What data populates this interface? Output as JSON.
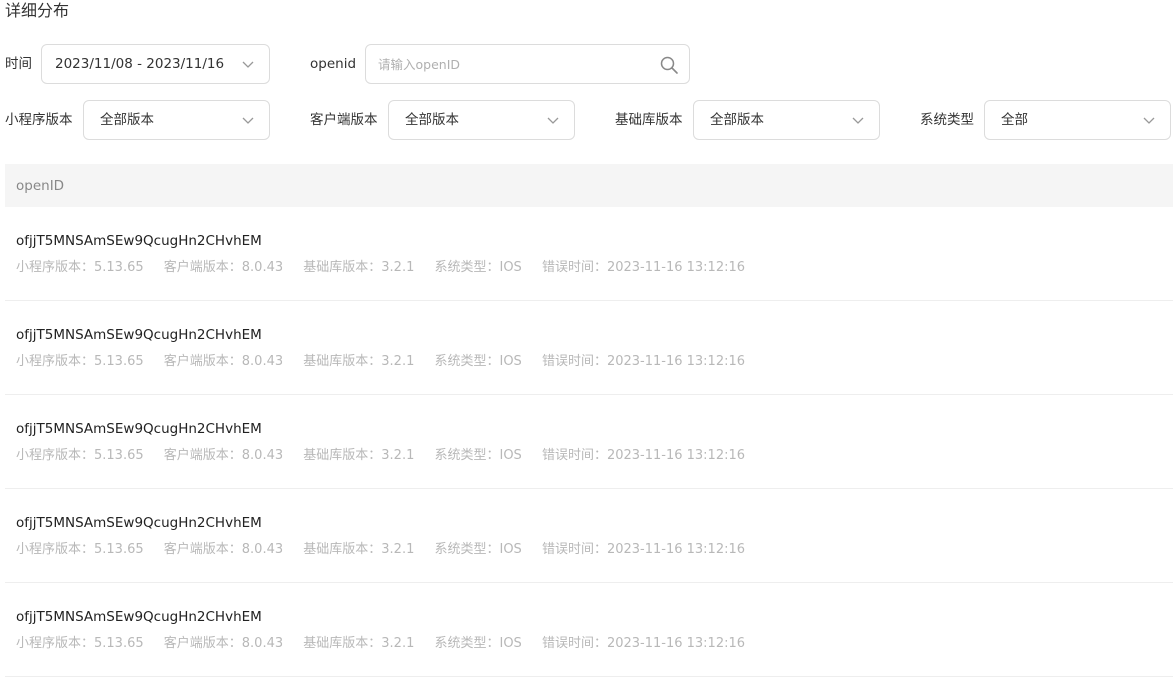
{
  "page": {
    "title": "详细分布"
  },
  "filters": {
    "time_label": "时间",
    "date_range": "2023/11/08 - 2023/11/16",
    "openid_label": "openid",
    "openid_placeholder": "请输入openID",
    "miniprogram_label": "小程序版本",
    "miniprogram_value": "全部版本",
    "client_label": "客户端版本",
    "client_value": "全部版本",
    "baselib_label": "基础库版本",
    "baselib_value": "全部版本",
    "os_label": "系统类型",
    "os_value": "全部"
  },
  "table": {
    "header": "openID",
    "rows": [
      {
        "openid": "ofjjT5MNSAmSEw9QcugHn2CHvhEM",
        "miniprogram": "小程序版本：5.13.65",
        "client": "客户端版本：8.0.43",
        "baselib": "基础库版本：3.2.1",
        "os": "系统类型：IOS",
        "error_time": "错误时间：2023-11-16 13:12:16"
      },
      {
        "openid": "ofjjT5MNSAmSEw9QcugHn2CHvhEM",
        "miniprogram": "小程序版本：5.13.65",
        "client": "客户端版本：8.0.43",
        "baselib": "基础库版本：3.2.1",
        "os": "系统类型：IOS",
        "error_time": "错误时间：2023-11-16 13:12:16"
      },
      {
        "openid": "ofjjT5MNSAmSEw9QcugHn2CHvhEM",
        "miniprogram": "小程序版本：5.13.65",
        "client": "客户端版本：8.0.43",
        "baselib": "基础库版本：3.2.1",
        "os": "系统类型：IOS",
        "error_time": "错误时间：2023-11-16 13:12:16"
      },
      {
        "openid": "ofjjT5MNSAmSEw9QcugHn2CHvhEM",
        "miniprogram": "小程序版本：5.13.65",
        "client": "客户端版本：8.0.43",
        "baselib": "基础库版本：3.2.1",
        "os": "系统类型：IOS",
        "error_time": "错误时间：2023-11-16 13:12:16"
      },
      {
        "openid": "ofjjT5MNSAmSEw9QcugHn2CHvhEM",
        "miniprogram": "小程序版本：5.13.65",
        "client": "客户端版本：8.0.43",
        "baselib": "基础库版本：3.2.1",
        "os": "系统类型：IOS",
        "error_time": "错误时间：2023-11-16 13:12:16"
      }
    ]
  }
}
